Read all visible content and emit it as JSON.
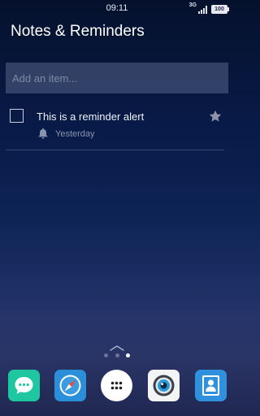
{
  "status_bar": {
    "time": "09:11",
    "network": "3G",
    "battery": "100"
  },
  "app": {
    "title": "Notes & Reminders"
  },
  "add_item": {
    "placeholder": "Add an item..."
  },
  "reminders": [
    {
      "title": "This is a reminder alert",
      "date": "Yesterday",
      "checked": false,
      "starred": false
    }
  ],
  "home": {
    "page_count": 3,
    "active_page": 3,
    "dock_apps": [
      "messages-icon",
      "browser-compass-icon",
      "app-drawer-icon",
      "camera-icon",
      "contacts-icon"
    ]
  },
  "colors": {
    "messages": "#1fc7a1",
    "browser": "#2a8fd8",
    "contacts": "#2f90de"
  }
}
